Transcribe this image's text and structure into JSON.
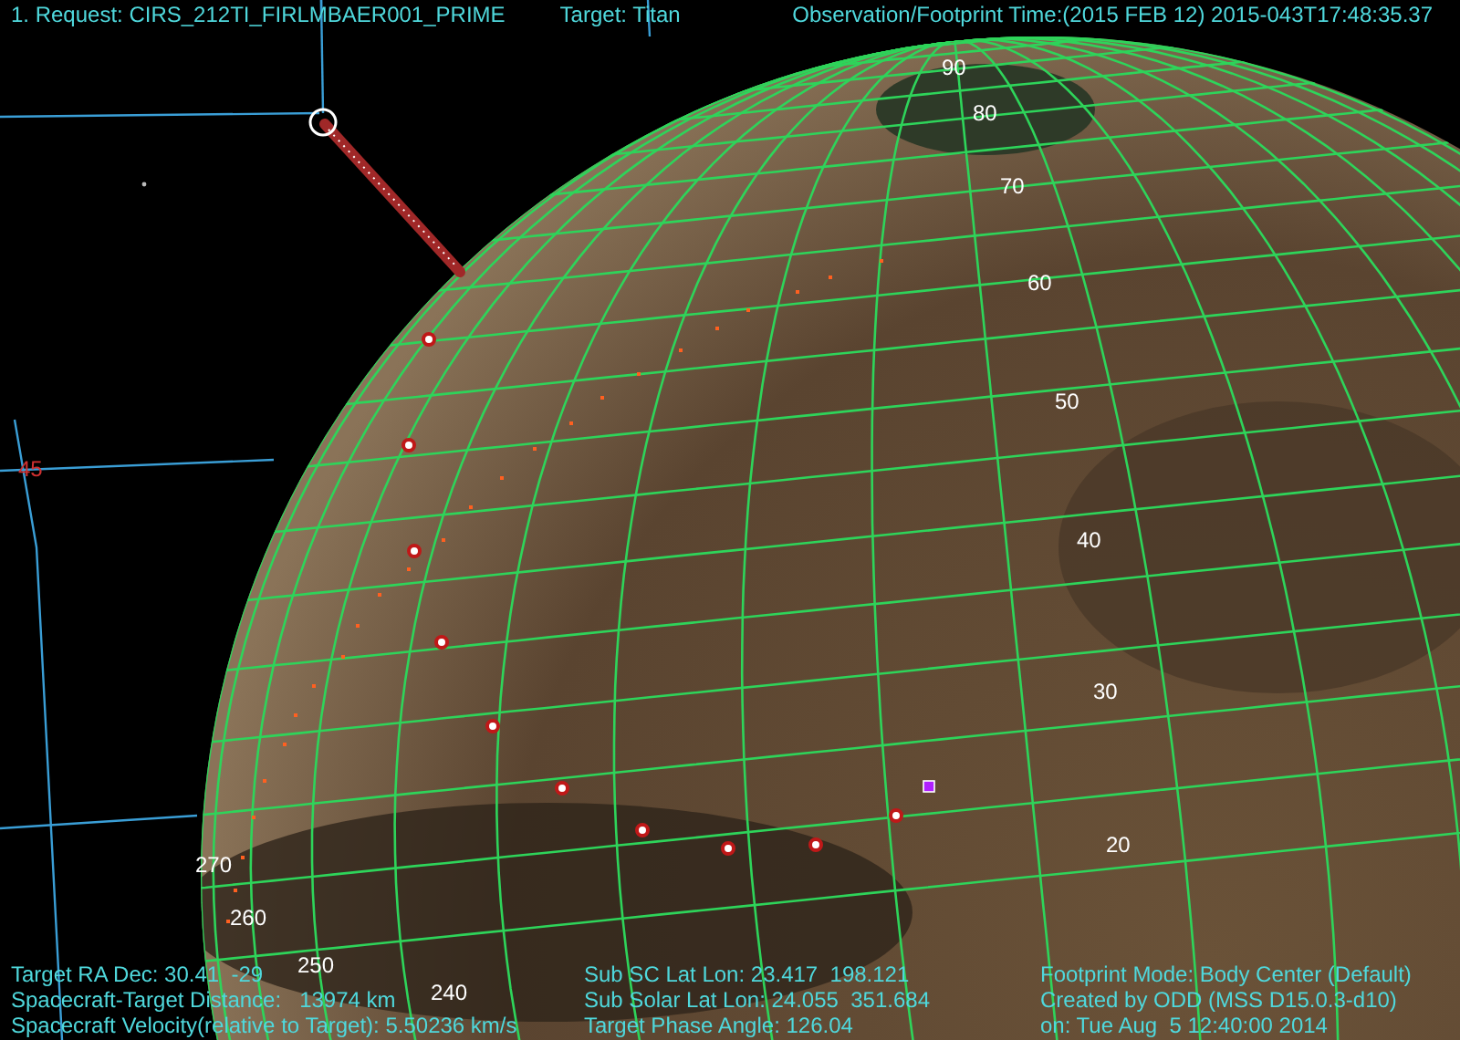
{
  "header": {
    "request": "1. Request: CIRS_212TI_FIRLMBAER001_PRIME",
    "target": "Target: Titan",
    "time": "Observation/Footprint Time:(2015 FEB 12) 2015-043T17:48:35.37"
  },
  "latitude_labels": [
    "90",
    "80",
    "70",
    "60",
    "50",
    "40",
    "30",
    "20"
  ],
  "longitude_labels": [
    "270",
    "260",
    "250",
    "240"
  ],
  "sky_grid_labels": [
    "45"
  ],
  "info_left": [
    "Target RA Dec: 30.41  -29",
    "Spacecraft-Target Distance:   13974 km",
    "Spacecraft Velocity(relative to Target): 5.50236 km/s"
  ],
  "info_center": [
    "Sub SC Lat Lon: 23.417  198.121",
    "Sub Solar Lat Lon: 24.055  351.684",
    "Target Phase Angle: 126.04"
  ],
  "info_right": [
    "Footprint Mode: Body Center (Default)",
    "Created by ODD (MSS D15.0.3-d10)",
    "on: Tue Aug  5 12:40:00 2014"
  ]
}
